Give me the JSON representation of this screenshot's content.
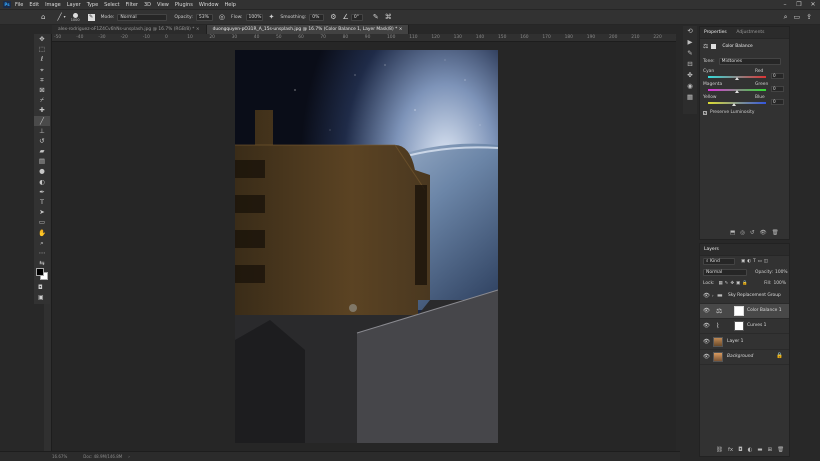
{
  "app": {
    "logo": "Ps"
  },
  "menu": [
    "File",
    "Edit",
    "Image",
    "Layer",
    "Type",
    "Select",
    "Filter",
    "3D",
    "View",
    "Plugins",
    "Window",
    "Help"
  ],
  "window_controls": [
    "–",
    "❐",
    "✕"
  ],
  "options": {
    "brush_size": "1000",
    "mode_label": "Mode:",
    "mode_value": "Normal",
    "opacity_label": "Opacity:",
    "opacity_value": "53%",
    "flow_label": "Flow:",
    "flow_value": "100%",
    "smoothing_label": "Smoothing:",
    "smoothing_value": "0%",
    "angle_value": "0°"
  },
  "tabs": [
    {
      "label": "alex-rodriguez-oF1Z4Cv6hNs-unsplash.jpg @ 16.7% (RGB/8) *",
      "close": "×"
    },
    {
      "label": "duongquyen-pO31R_A_15s-unsplash.jpg @ 16.7% (Color Balance 1, Layer Mask/8) *",
      "close": "×"
    }
  ],
  "ruler_h": [
    "-50",
    "-40",
    "-30",
    "-20",
    "-10",
    "0",
    "10",
    "20",
    "30",
    "40",
    "50",
    "60",
    "70",
    "80",
    "90",
    "100",
    "110",
    "120",
    "130",
    "140",
    "150",
    "160",
    "170",
    "180",
    "190",
    "200",
    "210",
    "220",
    "230"
  ],
  "status": {
    "zoom": "16.67%",
    "doc": "Doc: 48.9M/146.8M"
  },
  "properties": {
    "tab_properties": "Properties",
    "tab_adjustments": "Adjustments",
    "adjustment_title": "Color Balance",
    "tone_label": "Tone:",
    "tone_value": "Midtones",
    "sliders": [
      {
        "left": "Cyan",
        "right": "Red",
        "value": "0",
        "position": 0.5,
        "gradient": "#33dddd,#dd3333"
      },
      {
        "left": "Magenta",
        "right": "Green",
        "value": "0",
        "position": 0.5,
        "gradient": "#dd33dd,#33dd33"
      },
      {
        "left": "Yellow",
        "right": "Blue",
        "value": "0",
        "position": 0.45,
        "gradient": "#dddd33,#3355dd"
      }
    ],
    "preserve_label": "Preserve Luminosity"
  },
  "layers": {
    "title": "Layers",
    "kind_label": "Kind",
    "blend_mode": "Normal",
    "opacity_label": "Opacity:",
    "opacity_value": "100%",
    "lock_label": "Lock:",
    "fill_label": "Fill:",
    "fill_value": "100%",
    "items": [
      {
        "name": "Sky Replacement Group",
        "italic": false
      },
      {
        "name": "Color Balance 1",
        "italic": false
      },
      {
        "name": "Curves 1",
        "italic": false
      },
      {
        "name": "Layer 1",
        "italic": false
      },
      {
        "name": "Background",
        "italic": true
      }
    ]
  },
  "colors": {
    "accent": "#31a8ff",
    "panel": "#323232",
    "canvas_bg": "#262626"
  }
}
